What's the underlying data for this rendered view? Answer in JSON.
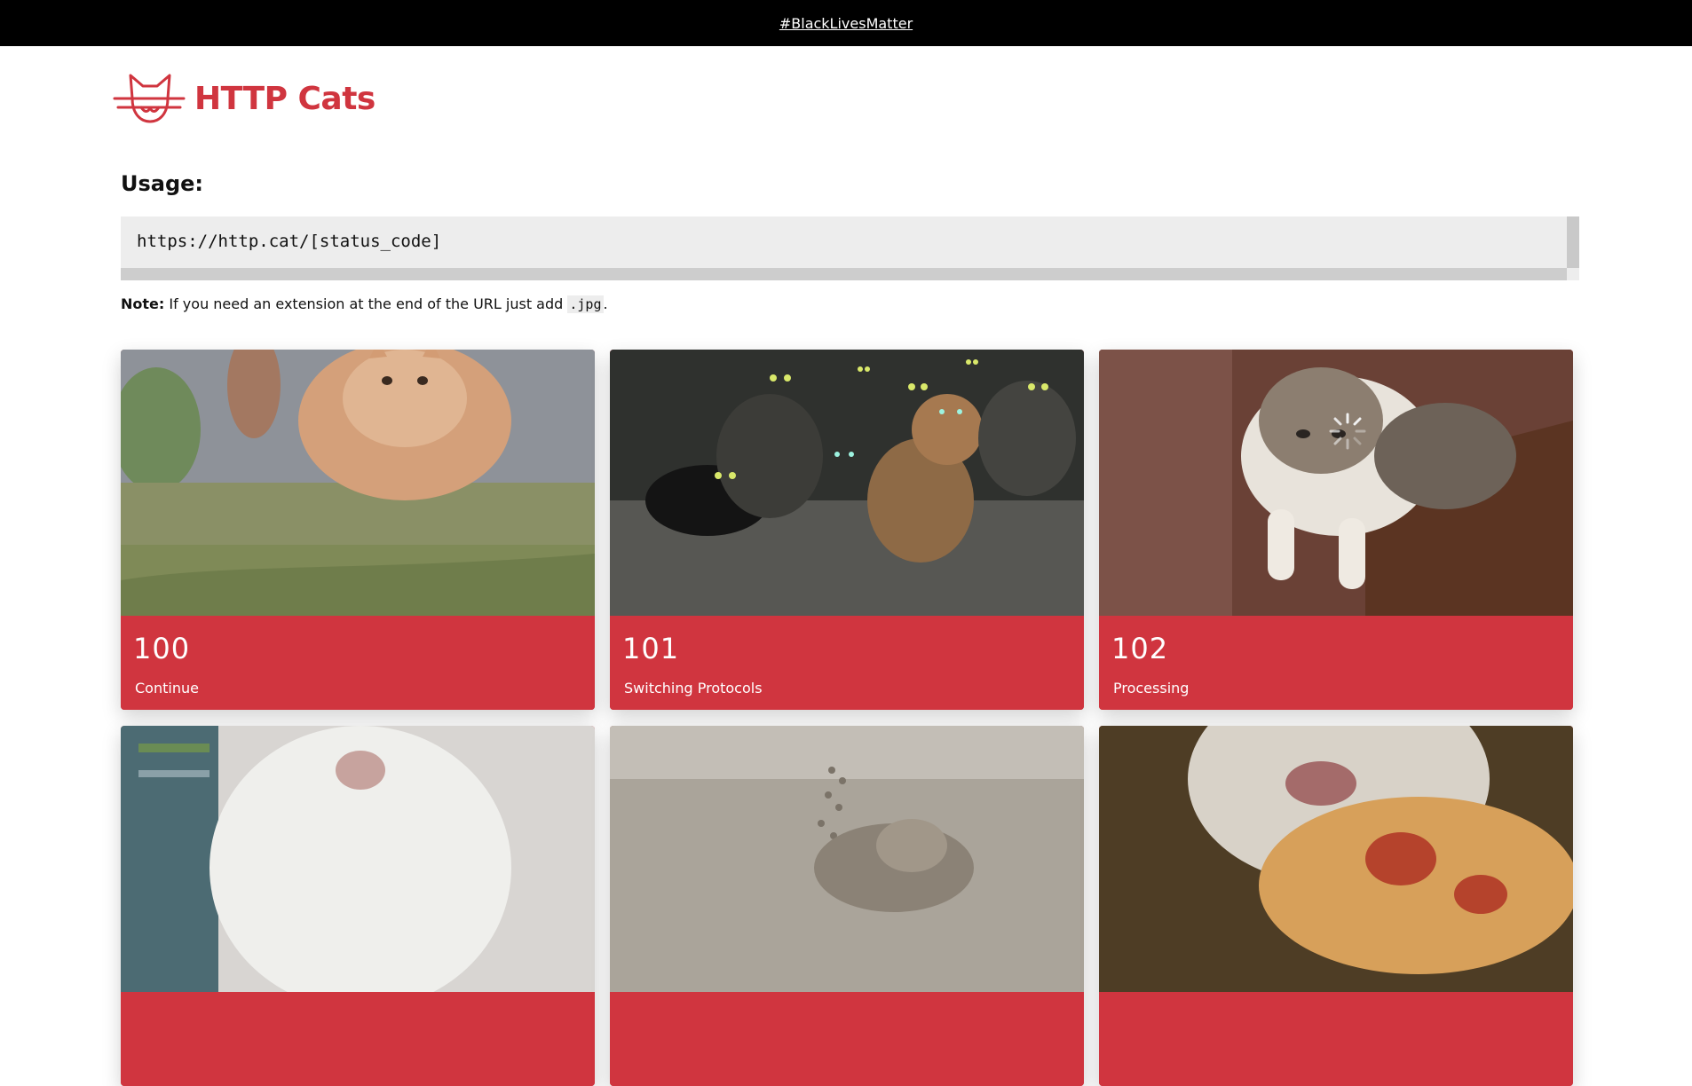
{
  "banner": {
    "link_text": "#BlackLivesMatter"
  },
  "header": {
    "title": "HTTP Cats",
    "brand_color": "#d0353f"
  },
  "usage": {
    "heading": "Usage:",
    "code": "https://http.cat/[status_code]",
    "note_label": "Note:",
    "note_text": " If you need an extension at the end of the URL just add ",
    "note_code": ".jpg",
    "note_end": "."
  },
  "cards": [
    {
      "code": "100",
      "text": "Continue"
    },
    {
      "code": "101",
      "text": "Switching Protocols"
    },
    {
      "code": "102",
      "text": "Processing"
    },
    {
      "code": "",
      "text": ""
    },
    {
      "code": "",
      "text": ""
    },
    {
      "code": "",
      "text": ""
    }
  ]
}
